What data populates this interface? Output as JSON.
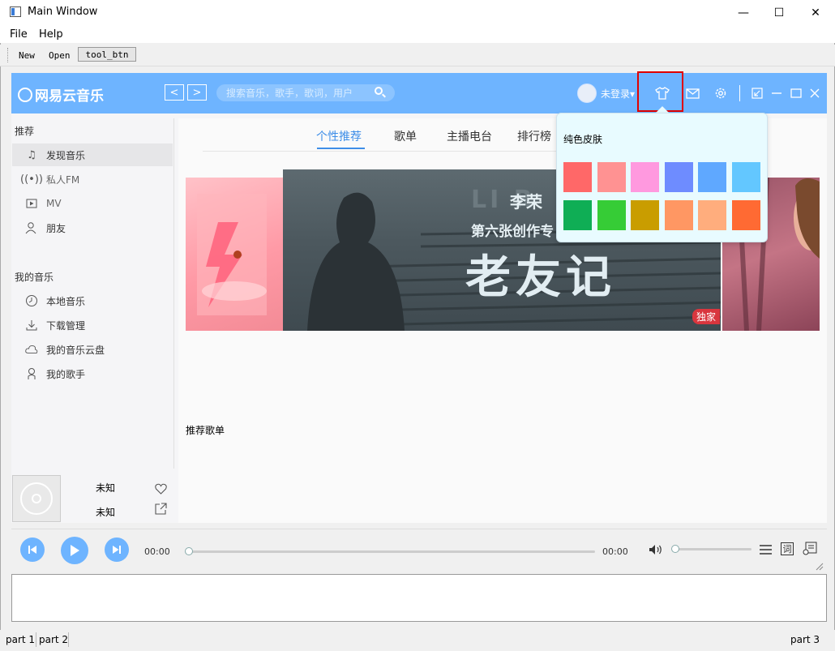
{
  "window": {
    "title": "Main Window",
    "min_glyph": "—",
    "max_glyph": "☐",
    "close_glyph": "✕"
  },
  "menu": [
    "File",
    "Help"
  ],
  "toolbar": {
    "new_label": "New",
    "open_label": "Open",
    "tool_btn_label": "tool_btn"
  },
  "app": {
    "logo_text": "网易云音乐",
    "nav_back": "<",
    "nav_forward": ">",
    "search_placeholder": "搜索音乐，歌手，歌词，用户",
    "user_label": "未登录▾",
    "accent_color": "#6eb4ff"
  },
  "sidebar": {
    "section1_title": "推荐",
    "section1_items": [
      {
        "label": "发现音乐",
        "icon": "music-note-icon",
        "active": true
      },
      {
        "label": "私人FM",
        "icon": "radio-icon"
      },
      {
        "label": "MV",
        "icon": "video-icon"
      },
      {
        "label": "朋友",
        "icon": "friends-icon"
      }
    ],
    "section2_title": "我的音乐",
    "section2_items": [
      {
        "label": "本地音乐",
        "icon": "clock-icon"
      },
      {
        "label": "下载管理",
        "icon": "download-icon"
      },
      {
        "label": "我的音乐云盘",
        "icon": "cloud-icon"
      },
      {
        "label": "我的歌手",
        "icon": "singer-icon"
      }
    ]
  },
  "tabs": [
    "个性推荐",
    "歌单",
    "主播电台",
    "排行榜"
  ],
  "banner": {
    "singer": "李荣",
    "subtitle": "第六张创作专",
    "album": "老友记",
    "badge": "独家",
    "bg_letters": "LI R"
  },
  "recommend_title": "推荐歌单",
  "now_playing": {
    "song": "未知",
    "artist": "未知"
  },
  "player": {
    "current_time": "00:00",
    "total_time": "00:00",
    "lyrics_label": "词"
  },
  "skin_popup": {
    "title": "纯色皮肤",
    "colors": [
      "#ff6868",
      "#ff9292",
      "#ff99df",
      "#6e8cff",
      "#5fa8ff",
      "#63c7ff",
      "#0fae55",
      "#36cc36",
      "#c99d00",
      "#ff9763",
      "#ffad7d",
      "#ff6a33"
    ]
  },
  "status": {
    "part1": "part 1",
    "part2": "part 2",
    "part3": "part 3"
  }
}
